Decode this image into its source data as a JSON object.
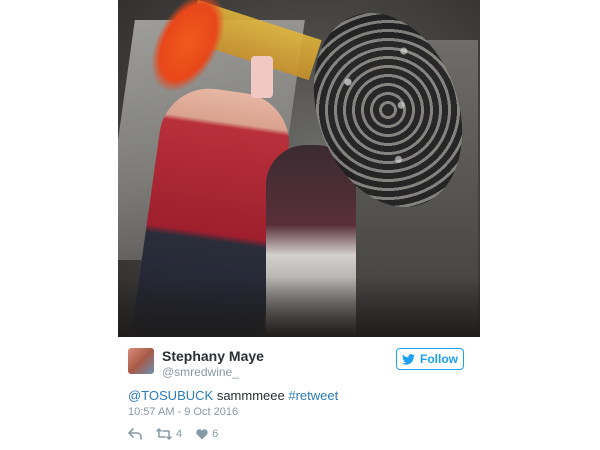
{
  "tweet": {
    "author": {
      "display_name": "Stephany Maye",
      "handle": "@smredwine_"
    },
    "follow_label": "Follow",
    "text": {
      "mention": "@TOSUBUCK",
      "body": " sammmeee ",
      "hashtag": "#retweet"
    },
    "timestamp": "10:57 AM - 9 Oct 2016",
    "stats": {
      "retweets": "4",
      "likes": "6"
    }
  },
  "colors": {
    "accent": "#1da1f2",
    "link": "#2b7bb9",
    "text": "#292f33",
    "muted": "#8899a6"
  },
  "icons": {
    "follow": "twitter-bird-icon",
    "reply": "reply-icon",
    "retweet": "retweet-icon",
    "like": "heart-icon"
  }
}
